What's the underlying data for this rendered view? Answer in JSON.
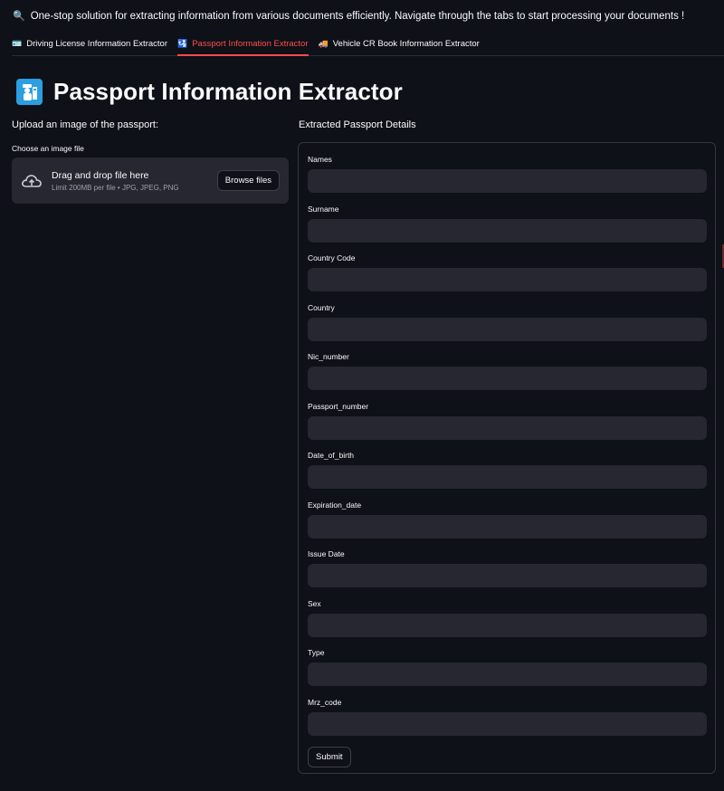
{
  "intro": {
    "icon": "magnifier-icon",
    "text": "One-stop solution for extracting information from various documents efficiently. Navigate through the tabs to start processing your documents !"
  },
  "tabs": [
    {
      "icon": "id-card-icon",
      "label": "Driving License Information Extractor"
    },
    {
      "icon": "passport-control-icon",
      "label": "Passport Information Extractor",
      "active": true
    },
    {
      "icon": "truck-icon",
      "label": "Vehicle CR Book Information Extractor"
    }
  ],
  "header": {
    "icon": "passport-control-icon",
    "title": "Passport Information Extractor"
  },
  "upload": {
    "heading": "Upload an image of the passport:",
    "label": "Choose an image file",
    "drop_text": "Drag and drop file here",
    "limit_text": "Limit 200MB per file • JPG, JPEG, PNG",
    "browse_label": "Browse files"
  },
  "details": {
    "heading": "Extracted Passport Details",
    "fields": [
      {
        "label": "Names",
        "value": ""
      },
      {
        "label": "Surname",
        "value": ""
      },
      {
        "label": "Country Code",
        "value": ""
      },
      {
        "label": "Country",
        "value": ""
      },
      {
        "label": "Nic_number",
        "value": ""
      },
      {
        "label": "Passport_number",
        "value": ""
      },
      {
        "label": "Date_of_birth",
        "value": ""
      },
      {
        "label": "Expiration_date",
        "value": ""
      },
      {
        "label": "Issue Date",
        "value": ""
      },
      {
        "label": "Sex",
        "value": ""
      },
      {
        "label": "Type",
        "value": ""
      },
      {
        "label": "Mrz_code",
        "value": ""
      }
    ],
    "submit_label": "Submit"
  },
  "colors": {
    "background": "#0e1117",
    "input": "#262730",
    "accent": "#ff4b4b",
    "badge": "#2c9fe0"
  }
}
